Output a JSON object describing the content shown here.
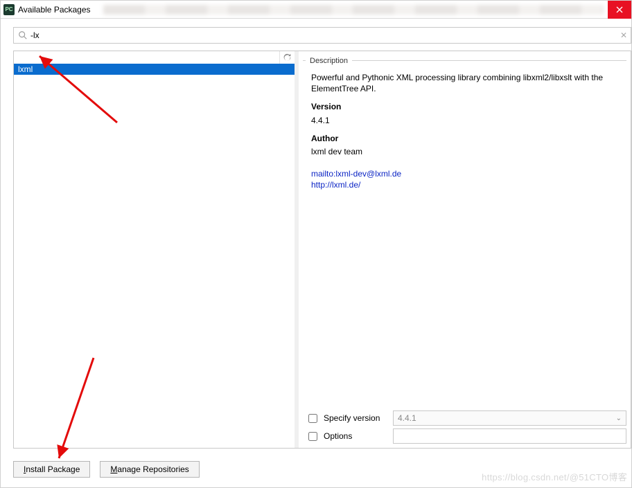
{
  "window": {
    "title": "Available Packages"
  },
  "search": {
    "value": "-lx"
  },
  "results": [
    {
      "name": "lxml",
      "selected": true
    }
  ],
  "details": {
    "section_label": "Description",
    "summary": "Powerful and Pythonic XML processing library combining libxml2/libxslt with the ElementTree API.",
    "version_label": "Version",
    "version": "4.4.1",
    "author_label": "Author",
    "author": "lxml dev team",
    "links": [
      "mailto:lxml-dev@lxml.de",
      "http://lxml.de/"
    ]
  },
  "options": {
    "specify_version_label": "Specify version",
    "specify_version_value": "4.4.1",
    "options_label": "Options",
    "options_value": ""
  },
  "buttons": {
    "install": "Install Package",
    "manage": "Manage Repositories"
  },
  "watermark": "https://blog.csdn.net/@51CTO博客"
}
